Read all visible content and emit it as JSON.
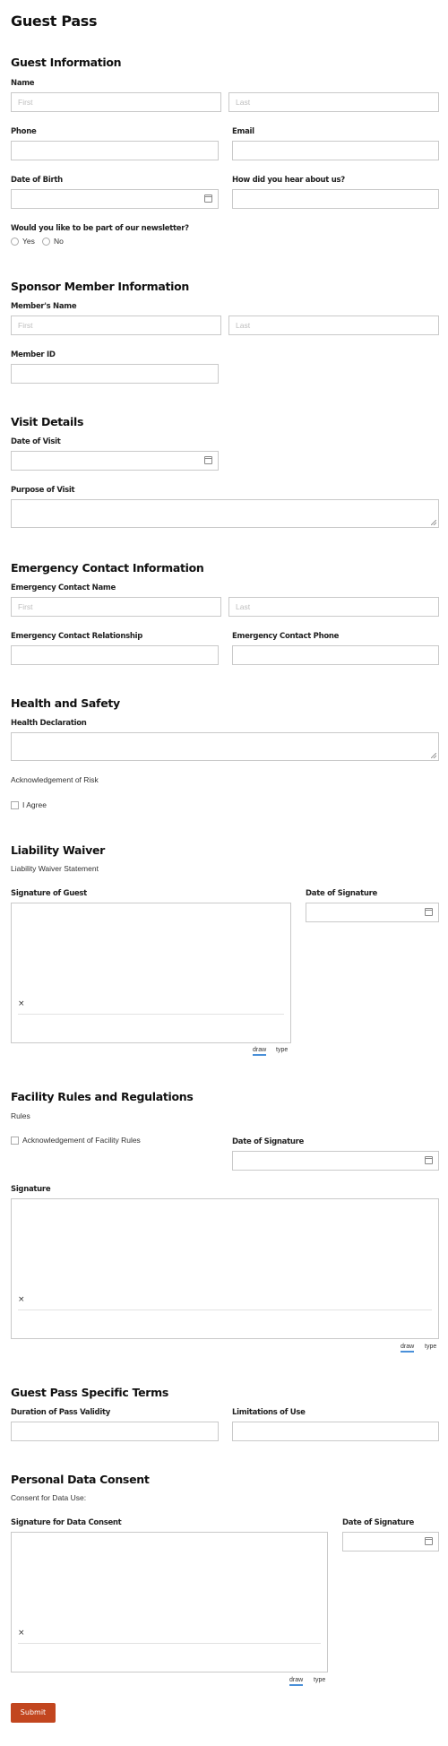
{
  "title": "Guest Pass",
  "guest_info": {
    "title": "Guest Information",
    "name_label": "Name",
    "first_ph": "First",
    "last_ph": "Last",
    "phone_label": "Phone",
    "email_label": "Email",
    "dob_label": "Date of Birth",
    "hear_label": "How did you hear about us?",
    "newsletter_label": "Would you like to be part of our newsletter?",
    "newsletter_options": [
      "Yes",
      "No"
    ]
  },
  "sponsor": {
    "title": "Sponsor Member Information",
    "name_label": "Member's Name",
    "first_ph": "First",
    "last_ph": "Last",
    "id_label": "Member ID"
  },
  "visit": {
    "title": "Visit Details",
    "date_label": "Date of Visit",
    "purpose_label": "Purpose of Visit"
  },
  "emergency": {
    "title": "Emergency Contact Information",
    "name_label": "Emergency Contact Name",
    "first_ph": "First",
    "last_ph": "Last",
    "relationship_label": "Emergency Contact Relationship",
    "phone_label": "Emergency Contact Phone"
  },
  "health": {
    "title": "Health and Safety",
    "declaration_label": "Health Declaration",
    "ack_text": "Acknowledgement of Risk",
    "agree_label": "I Agree"
  },
  "liability": {
    "title": "Liability Waiver",
    "statement": "Liability Waiver Statement",
    "sig_label": "Signature of Guest",
    "date_label": "Date of Signature",
    "x_mark": "×",
    "draw_label": "draw",
    "type_label": "type"
  },
  "facility": {
    "title": "Facility Rules and Regulations",
    "rules_text": "Rules",
    "ack_label": "Acknowledgement of Facility Rules",
    "date_label": "Date of Signature",
    "sig_label": "Signature",
    "x_mark": "×",
    "draw_label": "draw",
    "type_label": "type"
  },
  "terms": {
    "title": "Guest Pass Specific Terms",
    "duration_label": "Duration of Pass Validity",
    "limitations_label": "Limitations of Use"
  },
  "consent": {
    "title": "Personal Data Consent",
    "consent_text": "Consent for Data Use:",
    "sig_label": "Signature for Data Consent",
    "date_label": "Date of Signature",
    "x_mark": "×",
    "draw_label": "draw",
    "type_label": "type"
  },
  "submit_label": "Submit",
  "colors": {
    "accent": "#c2461f",
    "tab_underline": "#4a90d9",
    "border": "#c9c9c9"
  }
}
